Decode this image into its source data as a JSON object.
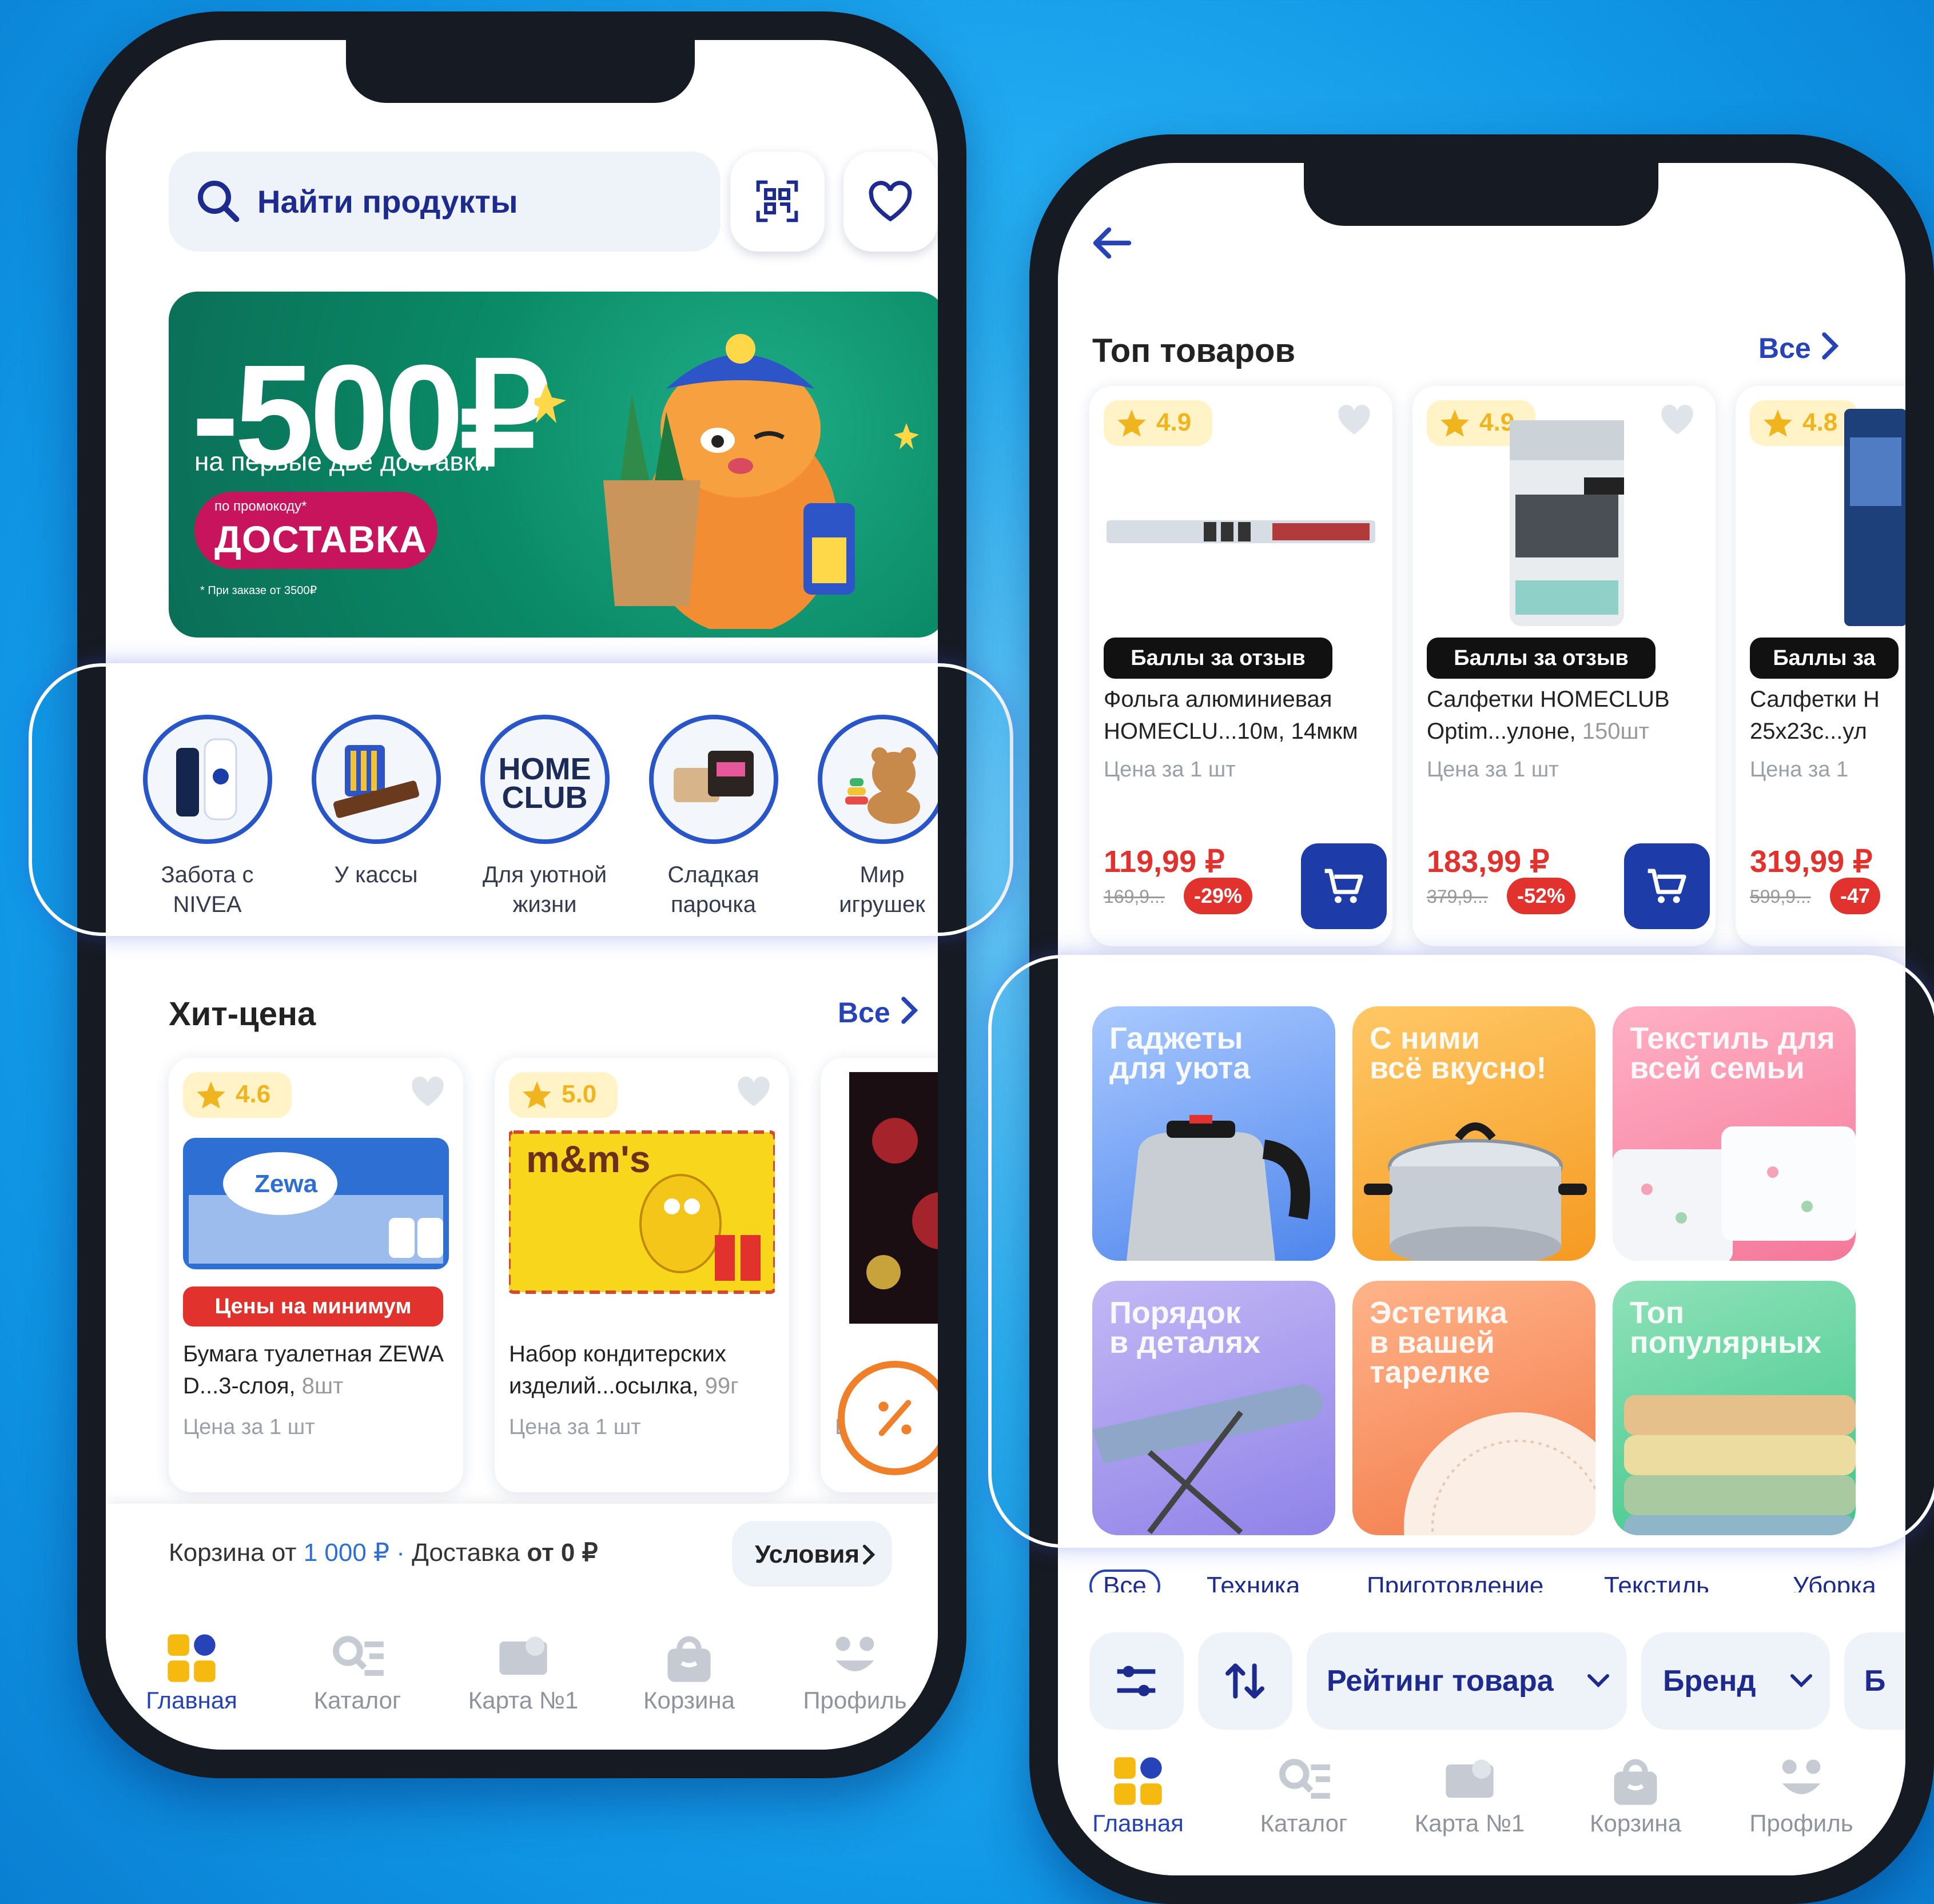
{
  "left": {
    "search_placeholder": "Найти продукты",
    "banner": {
      "headline": "-500₽",
      "subtitle": "на первые две доставки",
      "promo_small": "по промокоду*",
      "promo_code": "ДОСТАВКА",
      "footnote": "* При заказе от 3500₽"
    },
    "stories": [
      {
        "label": "Забота с NIVEA"
      },
      {
        "label": "У кассы"
      },
      {
        "label": "Для уютной жизни"
      },
      {
        "label": "Сладкая парочка"
      },
      {
        "label": "Мир игрушек"
      }
    ],
    "home_club": "HOME CLUB",
    "section_title": "Хит-цена",
    "section_all": "Все",
    "products": [
      {
        "rating": "4.6",
        "badge": "Цены на минимум",
        "name": "Бумага туалетная ZEWA D...3-слоя,",
        "qty": "8шт",
        "unit": "Цена за 1 шт"
      },
      {
        "rating": "5.0",
        "badge": "",
        "name": "Набор кондитерских изделий...осылка,",
        "qty": "99г",
        "unit": "Цена за 1 шт"
      }
    ],
    "third_peek": "Ц",
    "cart_bar": {
      "prefix": "Корзина от",
      "amount": "1 000 ₽",
      "sep": " · ",
      "delivery": "Доставка",
      "delivery_from": "от 0 ₽",
      "conditions": "Условия"
    },
    "nav": [
      "Главная",
      "Каталог",
      "Карта №1",
      "Корзина",
      "Профиль"
    ]
  },
  "right": {
    "section_title": "Топ товаров",
    "section_all": "Все",
    "products": [
      {
        "rating": "4.9",
        "badge": "Баллы за отзыв",
        "name1": "Фольга алюминиевая",
        "name2": "HOMECLU...10м, 14мкм",
        "unit": "Цена за 1 шт",
        "price": "119,99 ₽",
        "old": "169,9...",
        "discount": "-29%"
      },
      {
        "rating": "4.9",
        "badge": "Баллы за отзыв",
        "name1": "Салфетки HOMECLUB",
        "name2": "Optim...улоне,",
        "qty": "150шт",
        "unit": "Цена за 1 шт",
        "price": "183,99 ₽",
        "old": "379,9...",
        "discount": "-52%"
      },
      {
        "rating": "4.8",
        "badge": "Баллы за",
        "name1": "Салфетки Н",
        "name2": "25x23с...ул",
        "unit": "Цена за 1",
        "price": "319,99 ₽",
        "old": "599,9...",
        "discount": "-47"
      }
    ],
    "tiles": [
      {
        "l1": "Гаджеты",
        "l2": "для уюта"
      },
      {
        "l1": "С ними",
        "l2": "всё вкусно!"
      },
      {
        "l1": "Текстиль для",
        "l2": "всей семьи"
      },
      {
        "l1": "Порядок",
        "l2": "в деталях"
      },
      {
        "l1": "Эстетика",
        "l2": "в вашей",
        "l3": "тарелке"
      },
      {
        "l1": "Топ",
        "l2": "популярных"
      }
    ],
    "tabs": [
      "Все",
      "Техника",
      "Приготовление",
      "Текстиль",
      "Уборка"
    ],
    "filters": {
      "rating": "Рейтинг товара",
      "brand": "Бренд",
      "more": "Б"
    },
    "nav": [
      "Главная",
      "Каталог",
      "Карта №1",
      "Корзина",
      "Профиль"
    ]
  },
  "colors": {
    "brand_blue": "#2743b8",
    "price_red": "#e2322d",
    "banner_green": "#0a8a66",
    "promo_pink": "#c8145c"
  }
}
